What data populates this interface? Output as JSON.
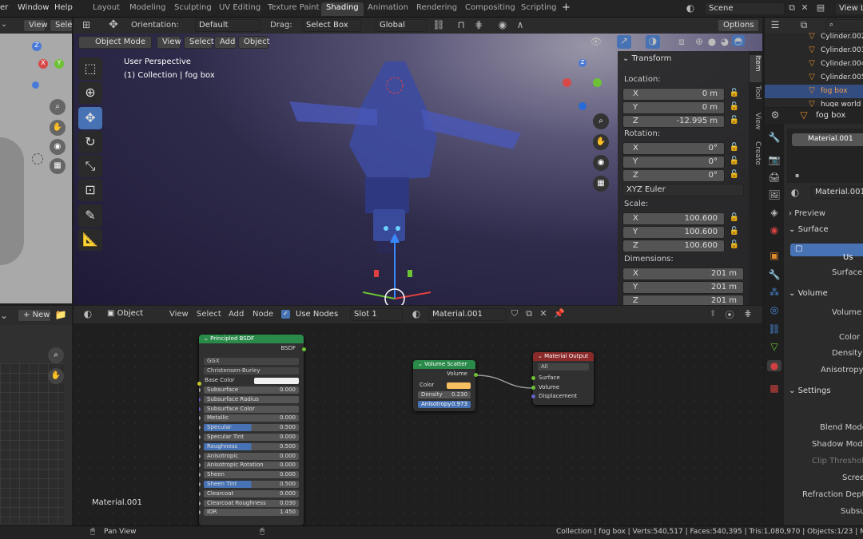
{
  "topbar": {
    "menu": [
      "er",
      "Window",
      "Help"
    ],
    "tabs": [
      "Layout",
      "Modeling",
      "Sculpting",
      "UV Editing",
      "Texture Paint",
      "Shading",
      "Animation",
      "Rendering",
      "Compositing",
      "Scripting"
    ],
    "plus": "+",
    "scene": "Scene",
    "view_layer": "View L"
  },
  "left_view": {
    "view": "View",
    "select": "Selec",
    "axes": {
      "x": "X",
      "y": "Y",
      "z": "Z"
    }
  },
  "viewport": {
    "orientation_label": "Orientation:",
    "orientation": "Default",
    "drag_label": "Drag:",
    "drag": "Select Box",
    "transform": "Global",
    "options": "Options",
    "mode": "Object Mode",
    "view": "View",
    "select": "Select",
    "add": "Add",
    "object": "Object",
    "overlay_title": "User Perspective",
    "overlay_sub": "(1) Collection | fog box",
    "gizmo": {
      "x": "X",
      "y": "Y",
      "z": "Z"
    }
  },
  "npanel": {
    "title": "Transform",
    "location_label": "Location:",
    "location": [
      {
        "a": "X",
        "v": "0 m"
      },
      {
        "a": "Y",
        "v": "0 m"
      },
      {
        "a": "Z",
        "v": "-12.995 m"
      }
    ],
    "rotation_label": "Rotation:",
    "rotation": [
      {
        "a": "X",
        "v": "0°"
      },
      {
        "a": "Y",
        "v": "0°"
      },
      {
        "a": "Z",
        "v": "0°"
      }
    ],
    "rot_mode": "XYZ Euler",
    "scale_label": "Scale:",
    "scale": [
      {
        "a": "X",
        "v": "100.600"
      },
      {
        "a": "Y",
        "v": "100.600"
      },
      {
        "a": "Z",
        "v": "100.600"
      }
    ],
    "dims_label": "Dimensions:",
    "dims": [
      {
        "a": "X",
        "v": "201 m"
      },
      {
        "a": "Y",
        "v": "201 m"
      },
      {
        "a": "Z",
        "v": "201 m"
      }
    ],
    "tabs": [
      "Item",
      "Tool",
      "View",
      "Create"
    ]
  },
  "outliner": {
    "items": [
      "Cylinder.002",
      "Cylinder.003",
      "Cylinder.004",
      "Cylinder.005",
      "fog box",
      "huge world"
    ]
  },
  "props": {
    "object": "fog box",
    "material_slot": "Material.001",
    "material": "Material.001",
    "preview": "Preview",
    "surface": "Surface",
    "use_nodes": "Us",
    "surface_label": "Surface",
    "volume": "Volume",
    "volume_label": "Volume",
    "color_label": "Color",
    "density_label": "Density",
    "anisotropy_label": "Anisotropy",
    "settings": "Settings",
    "blend_mode": "Blend Mode",
    "shadow_mode": "Shadow Mode",
    "clip": "Clip Threshold",
    "screen": "Scree",
    "refraction": "Refraction Depth",
    "subsurf": "Subsu"
  },
  "image_editor": {
    "new": "New"
  },
  "node_editor": {
    "editor": "Object",
    "view": "View",
    "select": "Select",
    "add": "Add",
    "node": "Node",
    "use_nodes": "Use Nodes",
    "slot": "Slot 1",
    "material": "Material.001",
    "label": "Material.001"
  },
  "bsdf": {
    "title": "Principled BSDF",
    "out": "BSDF",
    "dist": "GGX",
    "sss_method": "Christensen-Burley",
    "base_color": "Base Color",
    "rows": [
      {
        "n": "Subsurface",
        "v": "0.000",
        "blue": false
      },
      {
        "n": "Subsurface Radius",
        "v": "",
        "blue": false
      },
      {
        "n": "Subsurface Color",
        "v": "",
        "blue": false
      },
      {
        "n": "Metallic",
        "v": "0.000",
        "blue": false
      },
      {
        "n": "Specular",
        "v": "0.500",
        "blue": true
      },
      {
        "n": "Specular Tint",
        "v": "0.000",
        "blue": false
      },
      {
        "n": "Roughness",
        "v": "0.500",
        "blue": true
      },
      {
        "n": "Anisotropic",
        "v": "0.000",
        "blue": false
      },
      {
        "n": "Anisotropic Rotation",
        "v": "0.000",
        "blue": false
      },
      {
        "n": "Sheen",
        "v": "0.000",
        "blue": false
      },
      {
        "n": "Sheen Tint",
        "v": "0.500",
        "blue": true
      },
      {
        "n": "Clearcoat",
        "v": "0.000",
        "blue": false
      },
      {
        "n": "Clearcoat Roughness",
        "v": "0.030",
        "blue": false
      },
      {
        "n": "IOR",
        "v": "1.450",
        "blue": false
      }
    ]
  },
  "scatter": {
    "title": "Volume Scatter",
    "out": "Volume",
    "color": "Color",
    "density": "Density",
    "density_v": "0.230",
    "aniso": "Anisotropy",
    "aniso_v": "0.973"
  },
  "output": {
    "title": "Material Output",
    "target": "All",
    "surface": "Surface",
    "volume": "Volume",
    "disp": "Displacement"
  },
  "status": {
    "pan": "Pan View",
    "info": "Collection | fog box | Verts:540,517 | Faces:540,395 | Tris:1,080,970 | Objects:1/23 | Me"
  },
  "colors": {
    "accent": "#4772b3",
    "bsdf_header": "#2a8a4a",
    "output_header": "#8a2a2a",
    "selected": "#334d80"
  }
}
